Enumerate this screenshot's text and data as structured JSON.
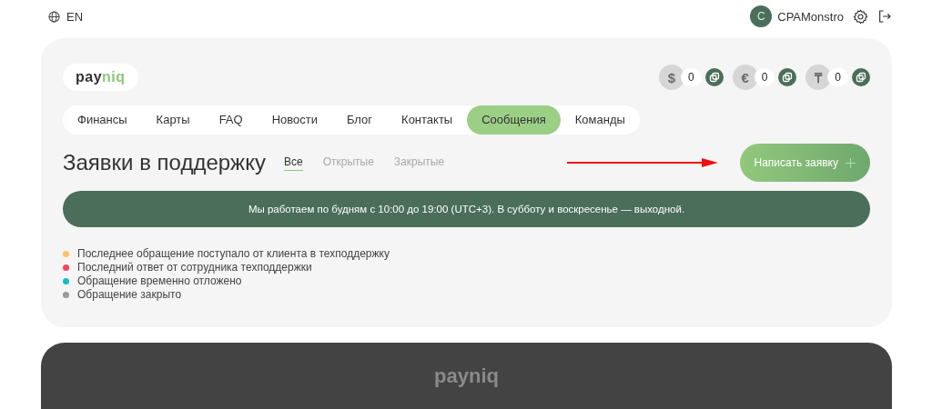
{
  "top_bar": {
    "language": "EN",
    "user": {
      "initial": "C",
      "name": "CPAMonstro"
    }
  },
  "header": {
    "logo": {
      "first": "pay",
      "second": "niq"
    },
    "balances": [
      {
        "symbol": "$",
        "value": "0"
      },
      {
        "symbol": "€",
        "value": "0"
      },
      {
        "symbol": "₸",
        "value": "0"
      }
    ]
  },
  "nav": [
    {
      "label": "Финансы",
      "selected": false
    },
    {
      "label": "Карты",
      "selected": false
    },
    {
      "label": "FAQ",
      "selected": false
    },
    {
      "label": "Новости",
      "selected": false
    },
    {
      "label": "Блог",
      "selected": false
    },
    {
      "label": "Контакты",
      "selected": false
    },
    {
      "label": "Сообщения",
      "selected": true
    },
    {
      "label": "Команды",
      "selected": false
    }
  ],
  "page": {
    "title": "Заявки в поддержку",
    "filters": [
      {
        "label": "Все",
        "selected": true
      },
      {
        "label": "Открытые",
        "selected": false
      },
      {
        "label": "Закрытые",
        "selected": false
      }
    ],
    "new_button": "Написать заявку",
    "notice": "Мы работаем по будням с 10:00 до 19:00 (UTC+3). В субботу и воскресенье — выходной.",
    "legend": [
      {
        "text": "Последнее обращение поступало от клиента в техподдержку",
        "color": "#fbc263"
      },
      {
        "text": "Последний ответ от сотрудника техподдержки",
        "color": "#f5455c"
      },
      {
        "text": "Обращение временно отложено",
        "color": "#13bfbf"
      },
      {
        "text": "Обращение закрыто",
        "color": "#9a9a9a"
      }
    ]
  },
  "footer": {
    "logo": {
      "first": "pay",
      "second": "niq"
    }
  }
}
